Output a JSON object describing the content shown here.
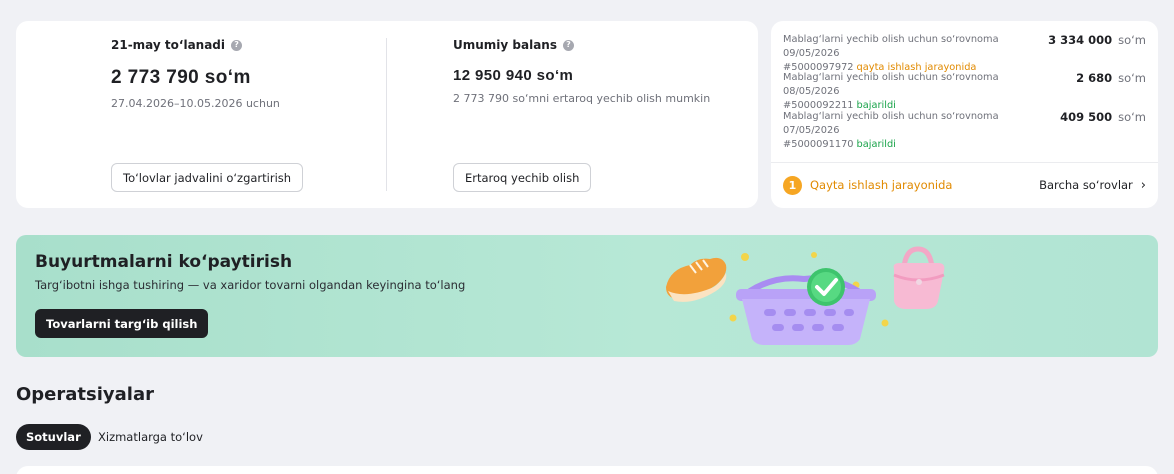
{
  "payout": {
    "label": "21-may to‘lanadi",
    "amount": "2 773 790 so‘m",
    "period": "27.04.2026–10.05.2026 uchun",
    "button": "To‘lovlar jadvalini o‘zgartirish"
  },
  "balance": {
    "label": "Umumiy balans",
    "amount": "12 950 940 so‘m",
    "note": "2 773 790 so‘mni ertaroq yechib olish mumkin",
    "button": "Ertaroq yechib olish"
  },
  "requests": {
    "items": [
      {
        "title": "Mablag‘larni yechib olish uchun so‘rovnoma 09/05/2026",
        "id": "#5000097972",
        "status": "qayta ishlash jarayonida",
        "status_type": "pending",
        "amount": "3 334 000",
        "currency": "so‘m"
      },
      {
        "title": "Mablag‘larni yechib olish uchun so‘rovnoma 08/05/2026",
        "id": "#5000092211",
        "status": "bajarildi",
        "status_type": "done",
        "amount": "2 680",
        "currency": "so‘m"
      },
      {
        "title": "Mablag‘larni yechib olish uchun so‘rovnoma 07/05/2026",
        "id": "#5000091170",
        "status": "bajarildi",
        "status_type": "done",
        "amount": "409 500",
        "currency": "so‘m"
      }
    ],
    "pending_count": "1",
    "pending_label": "Qayta ishlash jarayonida",
    "all_link": "Barcha so‘rovlar"
  },
  "promo": {
    "title": "Buyurtmalarni ko‘paytirish",
    "subtitle": "Targ‘ibotni ishga tushiring — va xaridor tovarni olgandan keyingina to‘lang",
    "button": "Tovarlarni targ‘ib qilish"
  },
  "operations": {
    "title": "Operatsiyalar",
    "tabs": [
      {
        "label": "Sotuvlar",
        "active": true
      },
      {
        "label": "Xizmatlarga to‘lov",
        "active": false
      }
    ]
  },
  "colors": {
    "pending": "#e18a00",
    "done": "#1aa34a",
    "banner": "#b1e4d3",
    "dark": "#1f2024"
  },
  "icons": {
    "info": "info-icon",
    "chevron": "chevron-right-icon",
    "shoe": "sneaker-icon",
    "basket": "shopping-basket-icon",
    "check": "checkmark-icon",
    "bag": "handbag-icon"
  }
}
